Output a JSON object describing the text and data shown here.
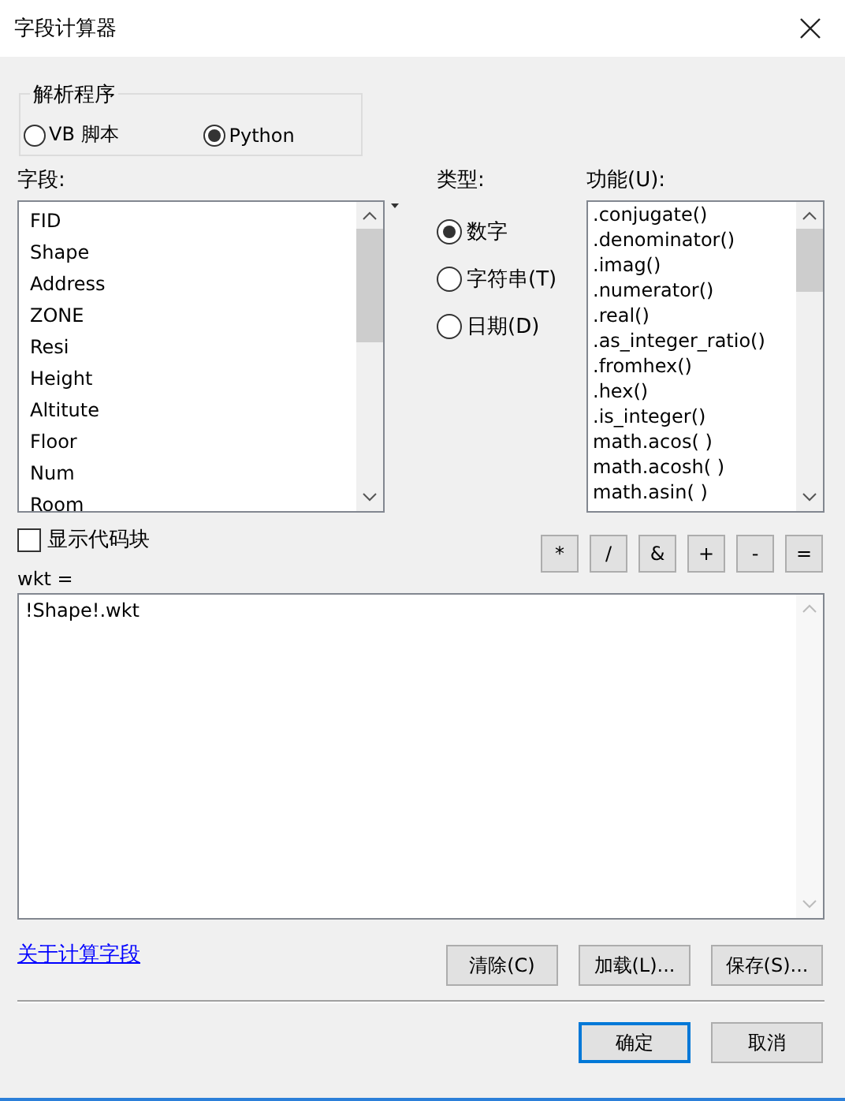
{
  "window": {
    "title": "字段计算器"
  },
  "parser": {
    "label": "解析程序",
    "options": [
      {
        "label": "VB 脚本",
        "selected": false
      },
      {
        "label": "Python",
        "selected": true
      }
    ]
  },
  "fields": {
    "label": "字段:",
    "items": [
      "FID",
      "Shape",
      "Address",
      "ZONE",
      "Resi",
      "Height",
      "Altitute",
      "Floor",
      "Num",
      "Room"
    ]
  },
  "type": {
    "label": "类型:",
    "options": [
      {
        "label": "数字",
        "selected": true
      },
      {
        "label": "字符串(T)",
        "selected": false
      },
      {
        "label": "日期(D)",
        "selected": false
      }
    ]
  },
  "functions": {
    "label": "功能(U):",
    "items": [
      ".conjugate()",
      ".denominator()",
      ".imag()",
      ".numerator()",
      ".real()",
      ".as_integer_ratio()",
      ".fromhex()",
      ".hex()",
      ".is_integer()",
      "math.acos( )",
      "math.acosh( )",
      "math.asin( )"
    ]
  },
  "show_codeblock": {
    "label": "显示代码块",
    "checked": false
  },
  "operators": [
    "*",
    "/",
    "&",
    "+",
    "-",
    "="
  ],
  "expression": {
    "label": "wkt =",
    "value": "!Shape!.wkt"
  },
  "help_link": "关于计算字段",
  "actions": [
    "清除(C)",
    "加载(L)...",
    "保存(S)..."
  ],
  "buttons": [
    {
      "label": "确定",
      "default": true
    },
    {
      "label": "取消",
      "default": false
    }
  ]
}
